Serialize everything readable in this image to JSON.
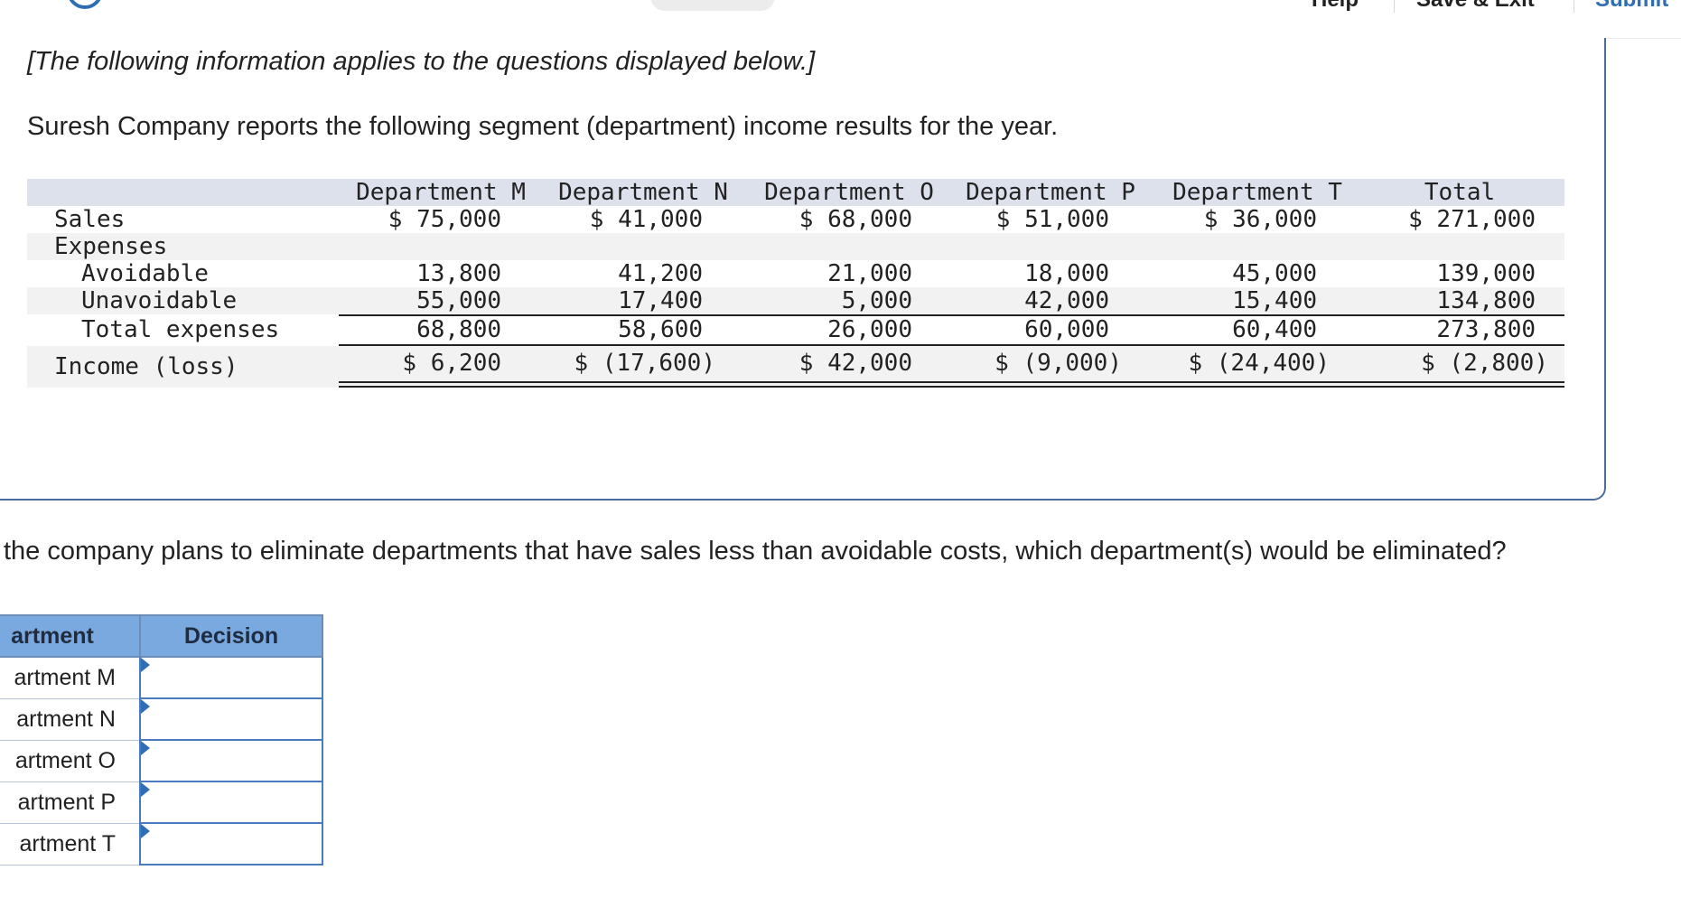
{
  "toolbar": {
    "help_label": "Help",
    "save_exit_label": "Save & Exit",
    "submit_label": "Submit"
  },
  "info": {
    "note": "[The following information applies to the questions displayed below.]",
    "intro": "Suresh Company reports the following segment (department) income results for the year."
  },
  "segment_table": {
    "headers": [
      "Department M",
      "Department N",
      "Department O",
      "Department P",
      "Department T",
      "Total"
    ],
    "rows": {
      "sales": {
        "label": "Sales",
        "values": [
          "$ 75,000",
          "$ 41,000",
          "$ 68,000",
          "$ 51,000",
          "$ 36,000",
          "$ 271,000"
        ]
      },
      "expenses": {
        "label": "Expenses"
      },
      "avoidable": {
        "label": "Avoidable",
        "values": [
          "13,800",
          "41,200",
          "21,000",
          "18,000",
          "45,000",
          "139,000"
        ]
      },
      "unavoidable": {
        "label": "Unavoidable",
        "values": [
          "55,000",
          "17,400",
          "5,000",
          "42,000",
          "15,400",
          "134,800"
        ]
      },
      "total_expenses": {
        "label": "Total expenses",
        "values": [
          "68,800",
          "58,600",
          "26,000",
          "60,000",
          "60,400",
          "273,800"
        ]
      },
      "income": {
        "label": "Income (loss)",
        "values": [
          "$ 6,200",
          "$ (17,600)",
          "$ 42,000",
          "$ (9,000)",
          "$ (24,400)",
          "$ (2,800)"
        ]
      }
    }
  },
  "question": "the company plans to eliminate departments that have sales less than avoidable costs, which department(s) would be eliminated?",
  "answer_grid": {
    "col_department": "artment",
    "col_decision": "Decision",
    "rows": [
      "artment M",
      "artment N",
      "artment O",
      "artment P",
      "artment T"
    ]
  }
}
